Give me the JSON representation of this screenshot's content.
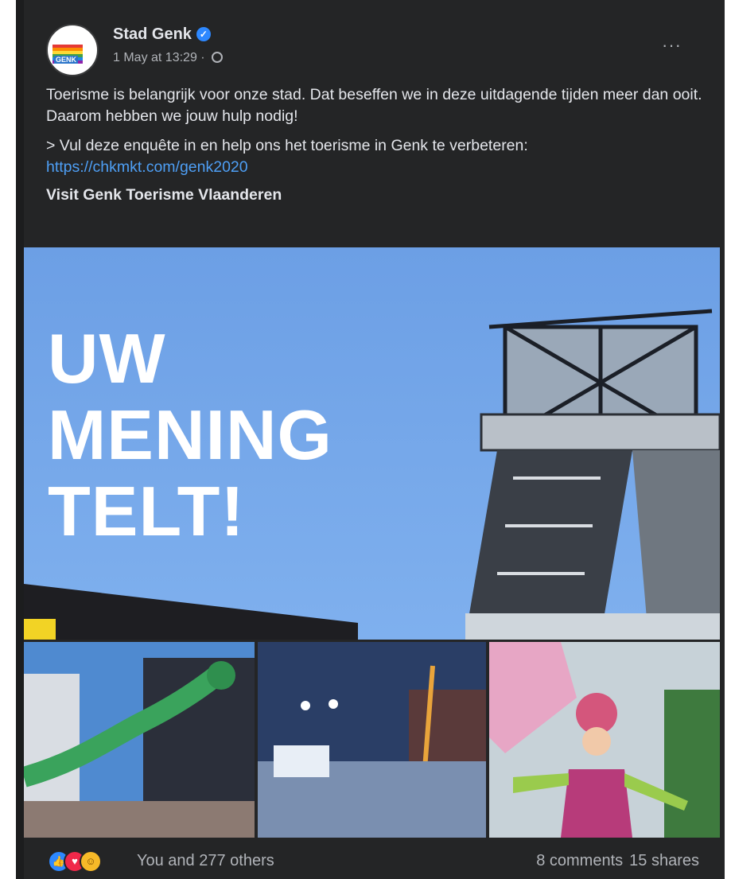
{
  "post": {
    "author": "Stad Genk",
    "timestamp": "1 May at 13:29",
    "meta_separator": " · ",
    "more_icon": "···",
    "avatar_logo_text": "GENK",
    "body_p1": "Toerisme is belangrijk voor onze stad. Dat beseffen we in deze uitdagende tijden meer dan ooit. Daarom hebben we jouw hulp nodig!",
    "body_p2_text": "> Vul deze enquête in en help ons het toerisme in Genk te verbeteren:",
    "body_link": "https://chkmkt.com/genk2020",
    "tags": "Visit Genk Toerisme Vlaanderen"
  },
  "hero": {
    "line1": "UW",
    "line2": "MENING",
    "line3": "TELT!"
  },
  "footer": {
    "reactions_text": "You and 277 others",
    "comments": "8 comments",
    "shares": "15 shares"
  },
  "colors": {
    "card_bg": "#242526",
    "text_primary": "#e4e6eb",
    "text_secondary": "#b0b3b8",
    "link": "#4e9ff5",
    "verified": "#2d88ff"
  }
}
